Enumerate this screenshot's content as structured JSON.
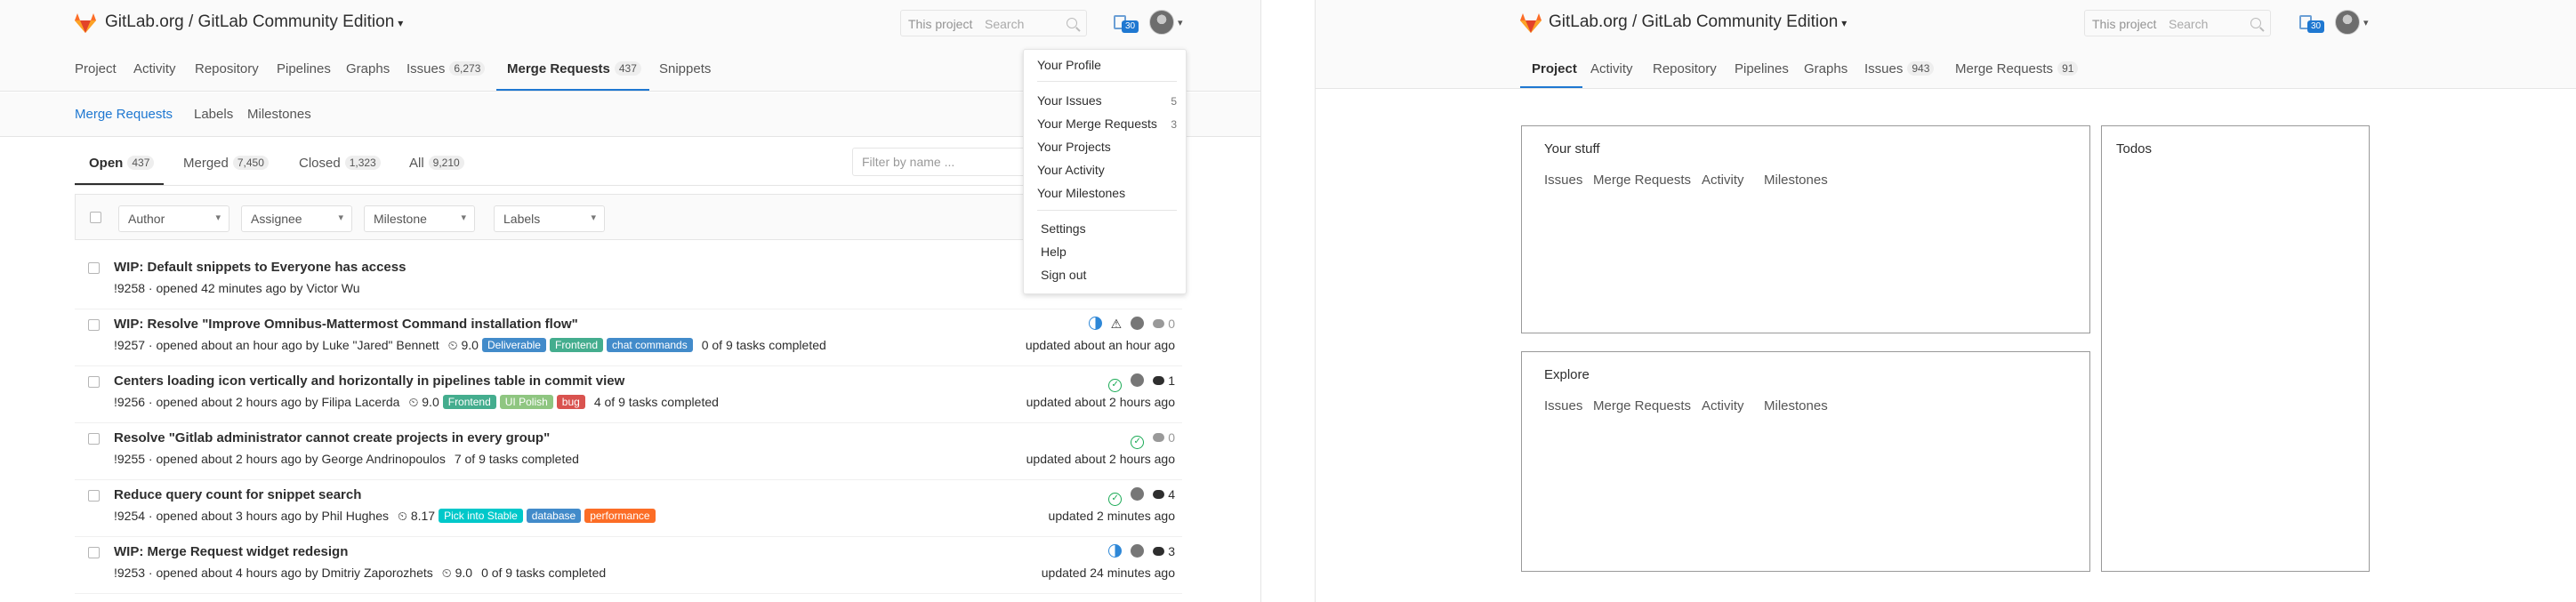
{
  "left": {
    "header": {
      "title": "GitLab.org / GitLab Community Edition",
      "search_scope": "This project",
      "search_placeholder": "Search",
      "todos_count": "30"
    },
    "nav": [
      {
        "label": "Project",
        "count": ""
      },
      {
        "label": "Activity",
        "count": ""
      },
      {
        "label": "Repository",
        "count": ""
      },
      {
        "label": "Pipelines",
        "count": ""
      },
      {
        "label": "Graphs",
        "count": ""
      },
      {
        "label": "Issues",
        "count": "6,273"
      },
      {
        "label": "Merge Requests",
        "count": "437"
      },
      {
        "label": "Snippets",
        "count": ""
      }
    ],
    "subnav": [
      "Merge Requests",
      "Labels",
      "Milestones"
    ],
    "tabs": [
      {
        "label": "Open",
        "count": "437"
      },
      {
        "label": "Merged",
        "count": "7,450"
      },
      {
        "label": "Closed",
        "count": "1,323"
      },
      {
        "label": "All",
        "count": "9,210"
      }
    ],
    "filter_placeholder": "Filter by name ...",
    "filters": [
      "Author",
      "Assignee",
      "Milestone",
      "Labels"
    ],
    "merge_requests": [
      {
        "title": "WIP: Default snippets to Everyone has access",
        "meta": "!9258 · opened 42 minutes ago by Victor Wu",
        "milestone": "",
        "labels": [],
        "tasks": "",
        "comments": "",
        "updated": ""
      },
      {
        "title": "WIP: Resolve \"Improve Omnibus-Mattermost Command installation flow\"",
        "meta": "!9257 · opened about an hour ago by Luke \"Jared\" Bennett",
        "milestone": "9.0",
        "labels": [
          {
            "text": "Deliverable",
            "color": "#428bca"
          },
          {
            "text": "Frontend",
            "color": "#44ad8e"
          },
          {
            "text": "chat commands",
            "color": "#428bca"
          }
        ],
        "tasks": "0 of 9 tasks completed",
        "comments": "0",
        "updated": "updated about an hour ago"
      },
      {
        "title": "Centers loading icon vertically and horizontally in pipelines table in commit view",
        "meta": "!9256 · opened about 2 hours ago by Filipa Lacerda",
        "milestone": "9.0",
        "labels": [
          {
            "text": "Frontend",
            "color": "#44ad8e"
          },
          {
            "text": "UI Polish",
            "color": "#8fc681"
          },
          {
            "text": "bug",
            "color": "#d9534f"
          }
        ],
        "tasks": "4 of 9 tasks completed",
        "comments": "1",
        "updated": "updated about 2 hours ago"
      },
      {
        "title": "Resolve \"Gitlab administrator cannot create projects in every group\"",
        "meta": "!9255 · opened about 2 hours ago by George Andrinopoulos",
        "milestone": "",
        "labels": [],
        "tasks": "7 of 9 tasks completed",
        "comments": "0",
        "updated": "updated about 2 hours ago"
      },
      {
        "title": "Reduce query count for snippet search",
        "meta": "!9254 · opened about 3 hours ago by Phil Hughes",
        "milestone": "8.17",
        "labels": [
          {
            "text": "Pick into Stable",
            "color": "#00c8ca"
          },
          {
            "text": "database",
            "color": "#428bca"
          },
          {
            "text": "performance",
            "color": "#fc6d26"
          }
        ],
        "tasks": "",
        "comments": "4",
        "updated": "updated 2 minutes ago"
      },
      {
        "title": "WIP: Merge Request widget redesign",
        "meta": "!9253 · opened about 4 hours ago by Dmitriy Zaporozhets",
        "milestone": "9.0",
        "labels": [],
        "tasks": "0 of 9 tasks completed",
        "comments": "3",
        "updated": "updated 24 minutes ago"
      }
    ],
    "user_menu": [
      {
        "label": "Your Profile",
        "count": ""
      },
      {
        "label": "Your Issues",
        "count": "5"
      },
      {
        "label": "Your Merge Requests",
        "count": "3"
      },
      {
        "label": "Your Projects",
        "count": ""
      },
      {
        "label": "Your Activity",
        "count": ""
      },
      {
        "label": "Your Milestones",
        "count": ""
      },
      {
        "label": "Settings",
        "count": ""
      },
      {
        "label": "Help",
        "count": ""
      },
      {
        "label": "Sign out",
        "count": ""
      }
    ]
  },
  "right": {
    "header": {
      "title": "GitLab.org / GitLab Community Edition",
      "search_scope": "This project",
      "search_placeholder": "Search",
      "todos_count": "30"
    },
    "nav": [
      {
        "label": "Project",
        "count": ""
      },
      {
        "label": "Activity",
        "count": ""
      },
      {
        "label": "Repository",
        "count": ""
      },
      {
        "label": "Pipelines",
        "count": ""
      },
      {
        "label": "Graphs",
        "count": ""
      },
      {
        "label": "Issues",
        "count": "943"
      },
      {
        "label": "Merge Requests",
        "count": "91"
      }
    ],
    "your_stuff": {
      "title": "Your stuff",
      "links": [
        "Issues",
        "Merge Requests",
        "Activity",
        "Milestones"
      ]
    },
    "explore": {
      "title": "Explore",
      "links": [
        "Issues",
        "Merge Requests",
        "Activity",
        "Milestones"
      ]
    },
    "todos": {
      "title": "Todos"
    }
  }
}
